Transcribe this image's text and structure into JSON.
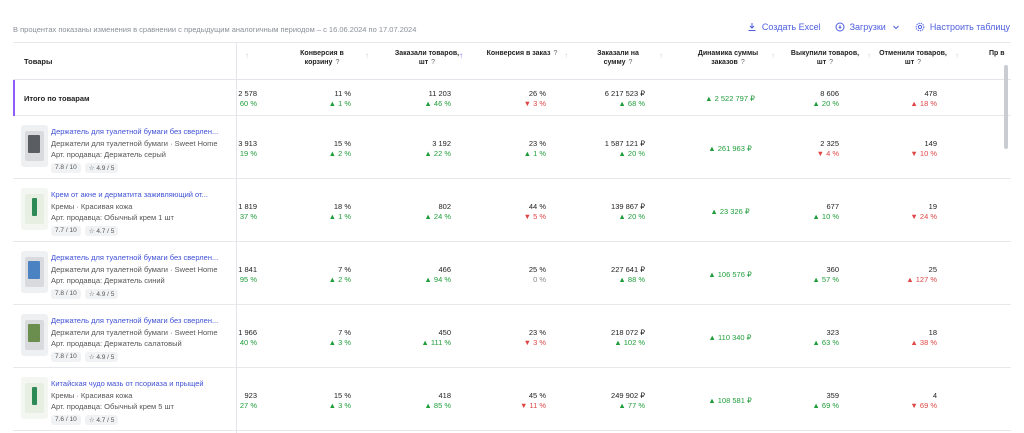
{
  "note": "В процентах показаны изменения в сравнении с предыдущим аналогичным периодом – с 16.06.2024 по 17.07.2024",
  "actions": {
    "excel": "Создать Excel",
    "downloads": "Загрузки",
    "settings": "Настроить таблицу"
  },
  "header": {
    "products": "Товары",
    "col_cut": "?",
    "conv_cart": "Конверсия в корзину",
    "ordered_qty": "Заказали товаров, шт",
    "conv_order": "Конверсия в заказ",
    "ordered_sum": "Заказали на сумму",
    "dyn_sum": "Динамика суммы заказов",
    "bought_qty": "Выкупили товаров, шт",
    "cancel_qty": "Отменили товаров, шт",
    "cut_last": "Пр в",
    "q": "?"
  },
  "total": {
    "label": "Итого по товарам",
    "c0": "2 578",
    "c0d": "60 %",
    "c1": "11 %",
    "c1d": "▲ 1 %",
    "c2": "11 203",
    "c2d": "▲ 46 %",
    "c3": "26 %",
    "c3d": "▼ 3 %",
    "c4": "6 217 523 ₽",
    "c4d": "▲ 68 %",
    "c5": "▲ 2 522 797 ₽",
    "c6": "8 606",
    "c6d": "▲ 20 %",
    "c7": "478",
    "c7d": "▲ 18 %"
  },
  "products": [
    {
      "name": "Держатель для туалетной бумаги без сверлен...",
      "category": "Держатели для туалетной бумаги · Sweet Home",
      "article": "Арт. продавца: Держатель серый",
      "rating1": "7.8 / 10",
      "rating2": "☆ 4.9 / 5",
      "c0": "3 913",
      "c0d": "19 %",
      "c1": "15 %",
      "c1d": "▲ 2 %",
      "c2": "3 192",
      "c2d": "▲ 22 %",
      "c3": "23 %",
      "c3d": "▲ 1 %",
      "c4": "1 587 121 ₽",
      "c4d": "▲ 20 %",
      "c5": "▲ 261 963 ₽",
      "c6": "2 325",
      "c6d": "▼ 4 %",
      "c7": "149",
      "c7d": "▼ 10 %"
    },
    {
      "name": "Крем от акне и дерматита заживляющий от...",
      "category": "Кремы · Красивая кожа",
      "article": "Арт. продавца: Обычный крем 1 шт",
      "rating1": "7.7 / 10",
      "rating2": "☆ 4.7 / 5",
      "c0": "1 819",
      "c0d": "37 %",
      "c1": "18 %",
      "c1d": "▲ 1 %",
      "c2": "802",
      "c2d": "▲ 24 %",
      "c3": "44 %",
      "c3d": "▼ 5 %",
      "c4": "139 867 ₽",
      "c4d": "▲ 20 %",
      "c5": "▲ 23 326 ₽",
      "c6": "677",
      "c6d": "▲ 10 %",
      "c7": "19",
      "c7d": "▼ 24 %"
    },
    {
      "name": "Держатель для туалетной бумаги без сверлен...",
      "category": "Держатели для туалетной бумаги · Sweet Home",
      "article": "Арт. продавца: Держатель синий",
      "rating1": "7.8 / 10",
      "rating2": "☆ 4.9 / 5",
      "c0": "1 841",
      "c0d": "95 %",
      "c1": "7 %",
      "c1d": "▲ 2 %",
      "c2": "466",
      "c2d": "▲ 94 %",
      "c3": "25 %",
      "c3d": "0 %",
      "c4": "227 641 ₽",
      "c4d": "▲ 88 %",
      "c5": "▲ 106 576 ₽",
      "c6": "360",
      "c6d": "▲ 57 %",
      "c7": "25",
      "c7d": "▲ 127 %"
    },
    {
      "name": "Держатель для туалетной бумаги без сверлен...",
      "category": "Держатели для туалетной бумаги · Sweet Home",
      "article": "Арт. продавца: Держатель салатовый",
      "rating1": "7.8 / 10",
      "rating2": "☆ 4.9 / 5",
      "c0": "1 966",
      "c0d": "40 %",
      "c1": "7 %",
      "c1d": "▲ 3 %",
      "c2": "450",
      "c2d": "▲ 111 %",
      "c3": "23 %",
      "c3d": "▼ 3 %",
      "c4": "218 072 ₽",
      "c4d": "▲ 102 %",
      "c5": "▲ 110 340 ₽",
      "c6": "323",
      "c6d": "▲ 63 %",
      "c7": "18",
      "c7d": "▲ 38 %"
    },
    {
      "name": "Китайская чудо мазь от псориаза и прыщей",
      "category": "Кремы · Красивая кожа",
      "article": "Арт. продавца: Обычный крем 5 шт",
      "rating1": "7.6 / 10",
      "rating2": "☆ 4.7 / 5",
      "c0": "923",
      "c0d": "27 %",
      "c1": "15 %",
      "c1d": "▲ 3 %",
      "c2": "418",
      "c2d": "▲ 85 %",
      "c3": "45 %",
      "c3d": "▼ 11 %",
      "c4": "249 902 ₽",
      "c4d": "▲ 77 %",
      "c5": "▲ 108 581 ₽",
      "c6": "359",
      "c6d": "▲ 69 %",
      "c7": "4",
      "c7d": "▼ 69 %"
    }
  ],
  "colors": {
    "accent": "#4d5fe0",
    "up": "#1f9d3a",
    "down": "#e04545",
    "highlight": "#8b5cf6"
  }
}
